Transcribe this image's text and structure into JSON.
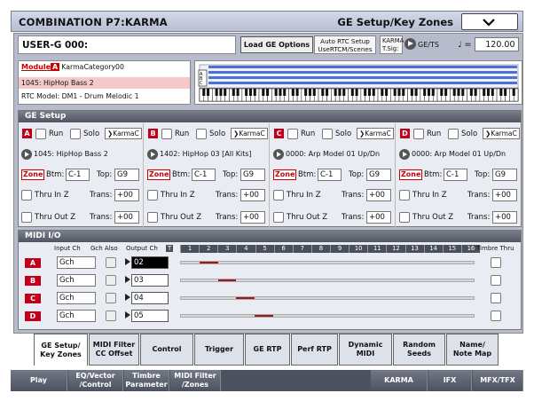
{
  "title_left": "COMBINATION P7:KARMA",
  "title_right": "GE Setup/Key Zones",
  "program": "USER-G 000:",
  "load_button": "Load GE Options",
  "auto_rtc": [
    "Auto RTC Setup",
    "UseRTCM/Scenes"
  ],
  "karma_tsig": [
    "KARMA",
    "T.Sig:"
  ],
  "gets": "GE/TS",
  "tempo_symbol": "♩ =",
  "tempo": "120.00",
  "module": {
    "tag": "Module",
    "letter": "A",
    "category": "KarmaCategory00",
    "program": "1045: HipHop Bass 2",
    "rtc": "RTC Model: DM1 - Drum Melodic 1"
  },
  "ge_setup": {
    "title": "GE Setup",
    "run": "Run",
    "solo": "Solo",
    "karmac": "KarmaC",
    "zone": "Zone",
    "btm": "Btm:",
    "top": "Top:",
    "thru_in": "Thru In Z",
    "thru_out": "Thru Out Z",
    "trans": "Trans:",
    "modules": [
      {
        "letter": "A",
        "ge": "1045: HipHop Bass 2",
        "btm": "C-1",
        "top": "G9",
        "trans_in": "+00",
        "trans_out": "+00"
      },
      {
        "letter": "B",
        "ge": "1402: HipHop 03 [All Kits]",
        "btm": "C-1",
        "top": "G9",
        "trans_in": "+00",
        "trans_out": "+00"
      },
      {
        "letter": "C",
        "ge": "0000: Arp Model 01 Up/Dn",
        "btm": "C-1",
        "top": "G9",
        "trans_in": "+00",
        "trans_out": "+00"
      },
      {
        "letter": "D",
        "ge": "0000: Arp Model 01 Up/Dn",
        "btm": "C-1",
        "top": "G9",
        "trans_in": "+00",
        "trans_out": "+00"
      }
    ]
  },
  "midi_io": {
    "title": "MIDI I/O",
    "headers": {
      "input": "Input Ch",
      "gch": "Gch Also",
      "output": "Output Ch",
      "t": "T",
      "timbre": "Timbre Thru"
    },
    "channels": [
      "1",
      "2",
      "3",
      "4",
      "5",
      "6",
      "7",
      "8",
      "9",
      "10",
      "11",
      "12",
      "13",
      "14",
      "15",
      "16"
    ],
    "rows": [
      {
        "letter": "A",
        "input": "Gch",
        "output": "02",
        "selected": true,
        "channel": 2
      },
      {
        "letter": "B",
        "input": "Gch",
        "output": "03",
        "selected": false,
        "channel": 3
      },
      {
        "letter": "C",
        "input": "Gch",
        "output": "04",
        "selected": false,
        "channel": 4
      },
      {
        "letter": "D",
        "input": "Gch",
        "output": "05",
        "selected": false,
        "channel": 5
      }
    ]
  },
  "tabs": [
    [
      "GE Setup/",
      "Key Zones"
    ],
    [
      "MIDI Filter",
      "CC Offset"
    ],
    [
      "Control"
    ],
    [
      "Trigger"
    ],
    [
      "GE RTP"
    ],
    [
      "Perf RTP"
    ],
    [
      "Dynamic",
      "MIDI"
    ],
    [
      "Random",
      "Seeds"
    ],
    [
      "Name/",
      "Note Map"
    ]
  ],
  "bottom_tabs": [
    [
      "Play"
    ],
    [
      "EQ/Vector",
      "/Control"
    ],
    [
      "Timbre",
      "Parameter"
    ],
    [
      "MIDI Filter",
      "/Zones"
    ],
    [
      "KARMA"
    ],
    [
      "IFX"
    ],
    [
      "MFX/TFX"
    ]
  ]
}
